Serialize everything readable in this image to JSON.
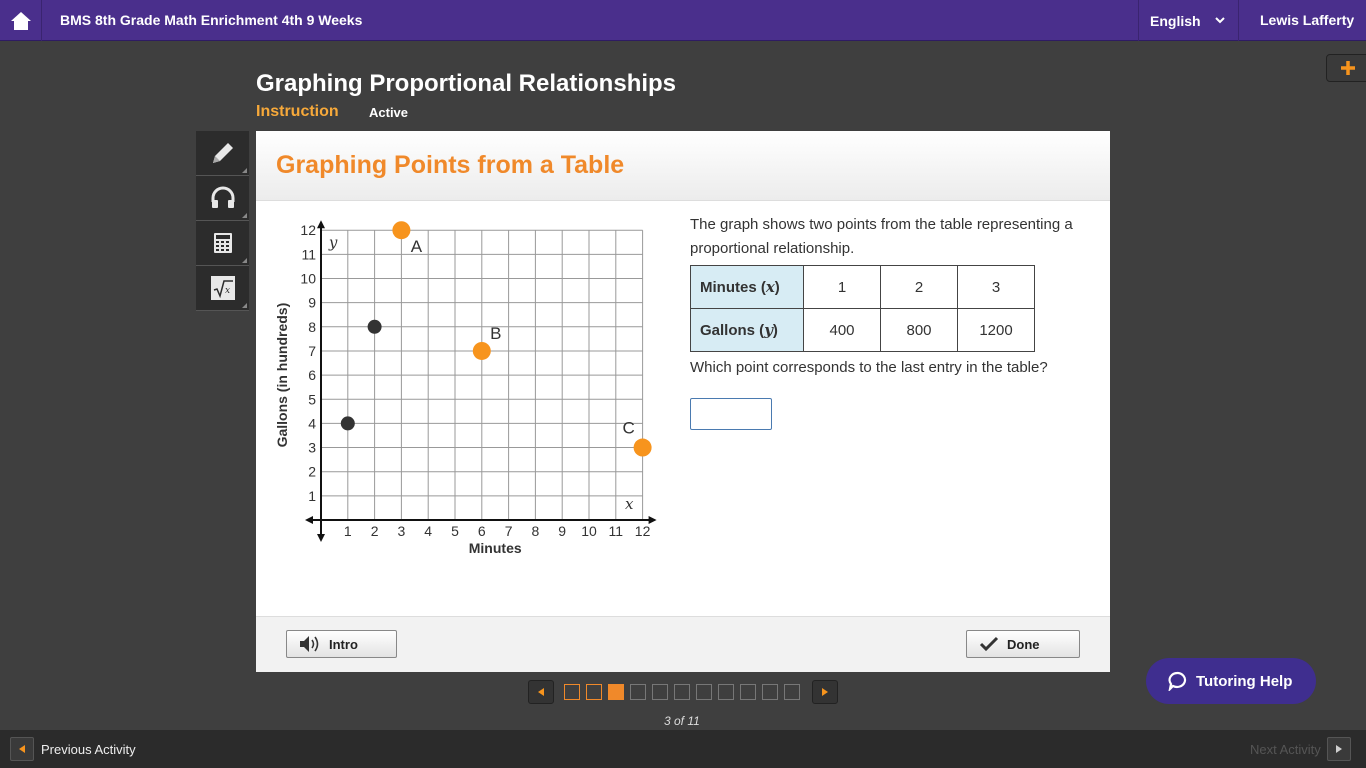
{
  "topbar": {
    "course_title": "BMS 8th Grade Math Enrichment 4th 9 Weeks",
    "language": "English",
    "user_name": "Lewis Lafferty"
  },
  "lesson": {
    "title": "Graphing Proportional Relationships",
    "type": "Instruction",
    "status": "Active"
  },
  "card": {
    "title": "Graphing Points from a Table",
    "question": "The graph shows two points from the table representing a proportional relationship.",
    "question2": "Which point corresponds to the last entry in the table?",
    "answer_value": ""
  },
  "table": {
    "rows": [
      {
        "header": "Minutes",
        "var": "x",
        "values": [
          "1",
          "2",
          "3"
        ]
      },
      {
        "header": "Gallons",
        "var": "y",
        "values": [
          "400",
          "800",
          "1200"
        ]
      }
    ]
  },
  "graph": {
    "xlabel": "Minutes",
    "ylabel": "Gallons (in hundreds)",
    "x_axis_letter": "x",
    "y_axis_letter": "y",
    "x_ticks": [
      "1",
      "2",
      "3",
      "4",
      "5",
      "6",
      "7",
      "8",
      "9",
      "10",
      "11",
      "12"
    ],
    "y_ticks": [
      "1",
      "2",
      "3",
      "4",
      "5",
      "6",
      "7",
      "8",
      "9",
      "10",
      "11",
      "12"
    ],
    "black_points": [
      {
        "x": 1,
        "y": 4
      },
      {
        "x": 2,
        "y": 8
      }
    ],
    "orange_points": [
      {
        "label": "A",
        "x": 3,
        "y": 12
      },
      {
        "label": "B",
        "x": 6,
        "y": 7
      },
      {
        "label": "C",
        "x": 12,
        "y": 3
      }
    ],
    "black_color": "#333333",
    "orange_color": "#f7941d"
  },
  "footer": {
    "intro_label": "Intro",
    "done_label": "Done"
  },
  "pager": {
    "count_text": "3 of 11",
    "current": 3,
    "total": 11
  },
  "tutoring_label": "Tutoring Help",
  "bottom": {
    "prev_label": "Previous Activity",
    "next_label": "Next Activity"
  },
  "colors": {
    "topbar": "#4a2f8c",
    "accent_orange": "#f0892a",
    "tutor_button": "#3f2e8f"
  }
}
